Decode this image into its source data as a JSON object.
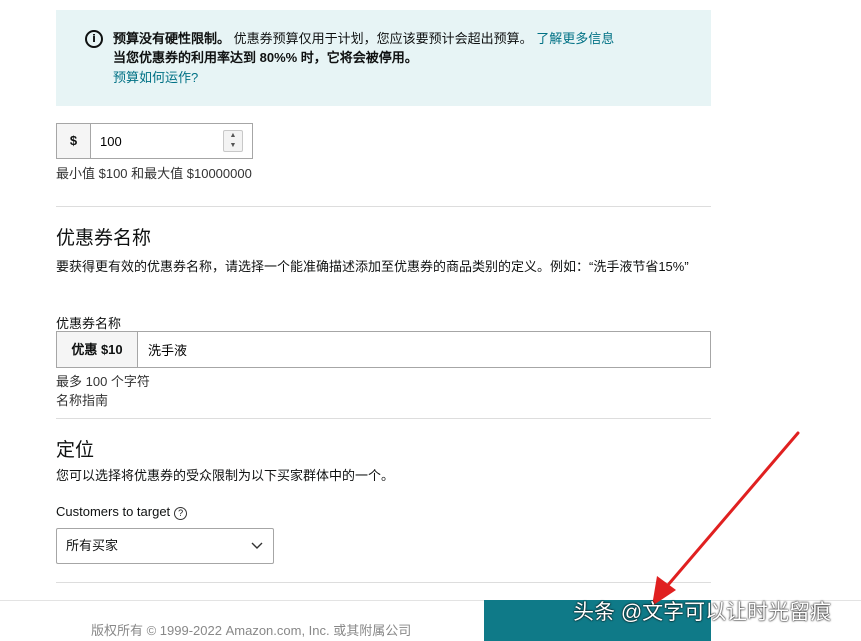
{
  "info_banner": {
    "icon": "info-icon",
    "bold_text": "预算没有硬性限制。",
    "text": "优惠券预算仅用于计划，您应该要预计会超出预算。",
    "learn_more_link": "了解更多信息",
    "line2": "当您优惠券的利用率达到 80%% 时，它将会被停用。",
    "how_link": "预算如何运作?"
  },
  "budget": {
    "currency_prefix": "$",
    "value": "100",
    "hint": "最小值 $100 和最大值 $10000000"
  },
  "coupon_name": {
    "section_title": "优惠券名称",
    "description": "要获得更有效的优惠券名称，请选择一个能准确描述添加至优惠券的商品类别的定义。例如：“洗手液节省15%”",
    "field_label": "优惠券名称",
    "prefix": "优惠 $10",
    "value": "洗手液",
    "hint": "最多 100 个字符",
    "guide_link": "名称指南"
  },
  "targeting": {
    "section_title": "定位",
    "description": "您可以选择将优惠券的受众限制为以下买家群体中的一个。",
    "field_label": "Customers to target",
    "help_icon": "help-icon",
    "selected": "所有买家"
  },
  "footer": {
    "copyright": "版权所有 © 1999-2022 Amazon.com, Inc. 或其附属公司"
  },
  "watermark": "头条 @文字可以让时光留痕",
  "colors": {
    "banner_bg": "#e7f4f5",
    "link": "#007185",
    "primary_button": "#0f7a88",
    "annotation_arrow": "#e02020"
  }
}
